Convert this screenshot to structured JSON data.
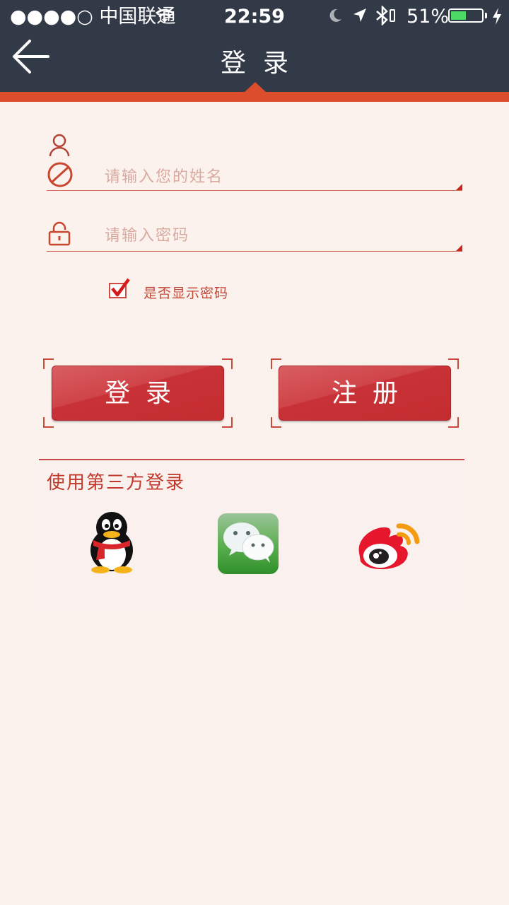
{
  "status_bar": {
    "carrier": "●●●●○ 中国联通",
    "time": "22:59",
    "battery_pct": "51%",
    "battery_level": 0.51
  },
  "nav": {
    "title": "登录"
  },
  "form": {
    "username_placeholder": "请输入您的姓名",
    "password_placeholder": "请输入密码",
    "show_password_label": "是否显示密码",
    "show_password_checked": true
  },
  "buttons": {
    "login_label": "登录",
    "register_label": "注册"
  },
  "third_party": {
    "title": "使用第三方登录",
    "providers": [
      "qq-icon",
      "wechat-icon",
      "weibo-icon"
    ]
  },
  "colors": {
    "nav_bg": "#323a48",
    "accent": "#dc4d2c",
    "button": "#c83236",
    "page_bg": "#fbf1ed"
  }
}
